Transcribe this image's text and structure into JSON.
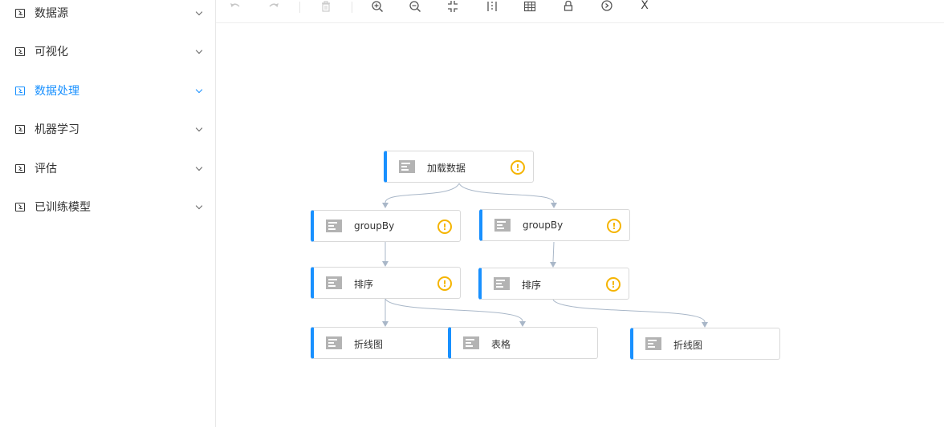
{
  "sidebar": {
    "items": [
      {
        "label": "数据源",
        "active": false
      },
      {
        "label": "可视化",
        "active": false
      },
      {
        "label": "数据处理",
        "active": true
      },
      {
        "label": "机器学习",
        "active": false
      },
      {
        "label": "评估",
        "active": false
      },
      {
        "label": "已训练模型",
        "active": false
      }
    ]
  },
  "toolbar": {
    "buttons": [
      {
        "name": "undo-icon",
        "enabled": false
      },
      {
        "name": "redo-icon",
        "enabled": false
      },
      {
        "name": "delete-icon",
        "enabled": false
      },
      {
        "name": "zoom-in-icon",
        "enabled": true
      },
      {
        "name": "zoom-out-icon",
        "enabled": true
      },
      {
        "name": "fit-view-icon",
        "enabled": true
      },
      {
        "name": "align-icon",
        "enabled": true
      },
      {
        "name": "grid-icon",
        "enabled": true
      },
      {
        "name": "lock-icon",
        "enabled": true
      },
      {
        "name": "run-icon",
        "enabled": true
      },
      {
        "name": "close-icon",
        "enabled": true
      }
    ],
    "close_glyph": "X"
  },
  "flow": {
    "nodes": [
      {
        "id": "load",
        "label": "加载数据",
        "warning": true
      },
      {
        "id": "groupby1",
        "label": "groupBy",
        "warning": true
      },
      {
        "id": "groupby2",
        "label": "groupBy",
        "warning": true
      },
      {
        "id": "sort1",
        "label": "排序",
        "warning": true
      },
      {
        "id": "sort2",
        "label": "排序",
        "warning": true
      },
      {
        "id": "line1",
        "label": "折线图",
        "warning": false
      },
      {
        "id": "table1",
        "label": "表格",
        "warning": false
      },
      {
        "id": "line2",
        "label": "折线图",
        "warning": false
      }
    ],
    "edges": [
      [
        "load",
        "groupby1"
      ],
      [
        "load",
        "groupby2"
      ],
      [
        "groupby1",
        "sort1"
      ],
      [
        "groupby2",
        "sort2"
      ],
      [
        "sort1",
        "line1"
      ],
      [
        "sort1",
        "table1"
      ],
      [
        "sort2",
        "line2"
      ]
    ],
    "warning_glyph": "!"
  },
  "colors": {
    "accent": "#1890ff",
    "warning": "#f5b400",
    "edge": "#a9b7c8",
    "node_icon": "#b3b3b3"
  }
}
